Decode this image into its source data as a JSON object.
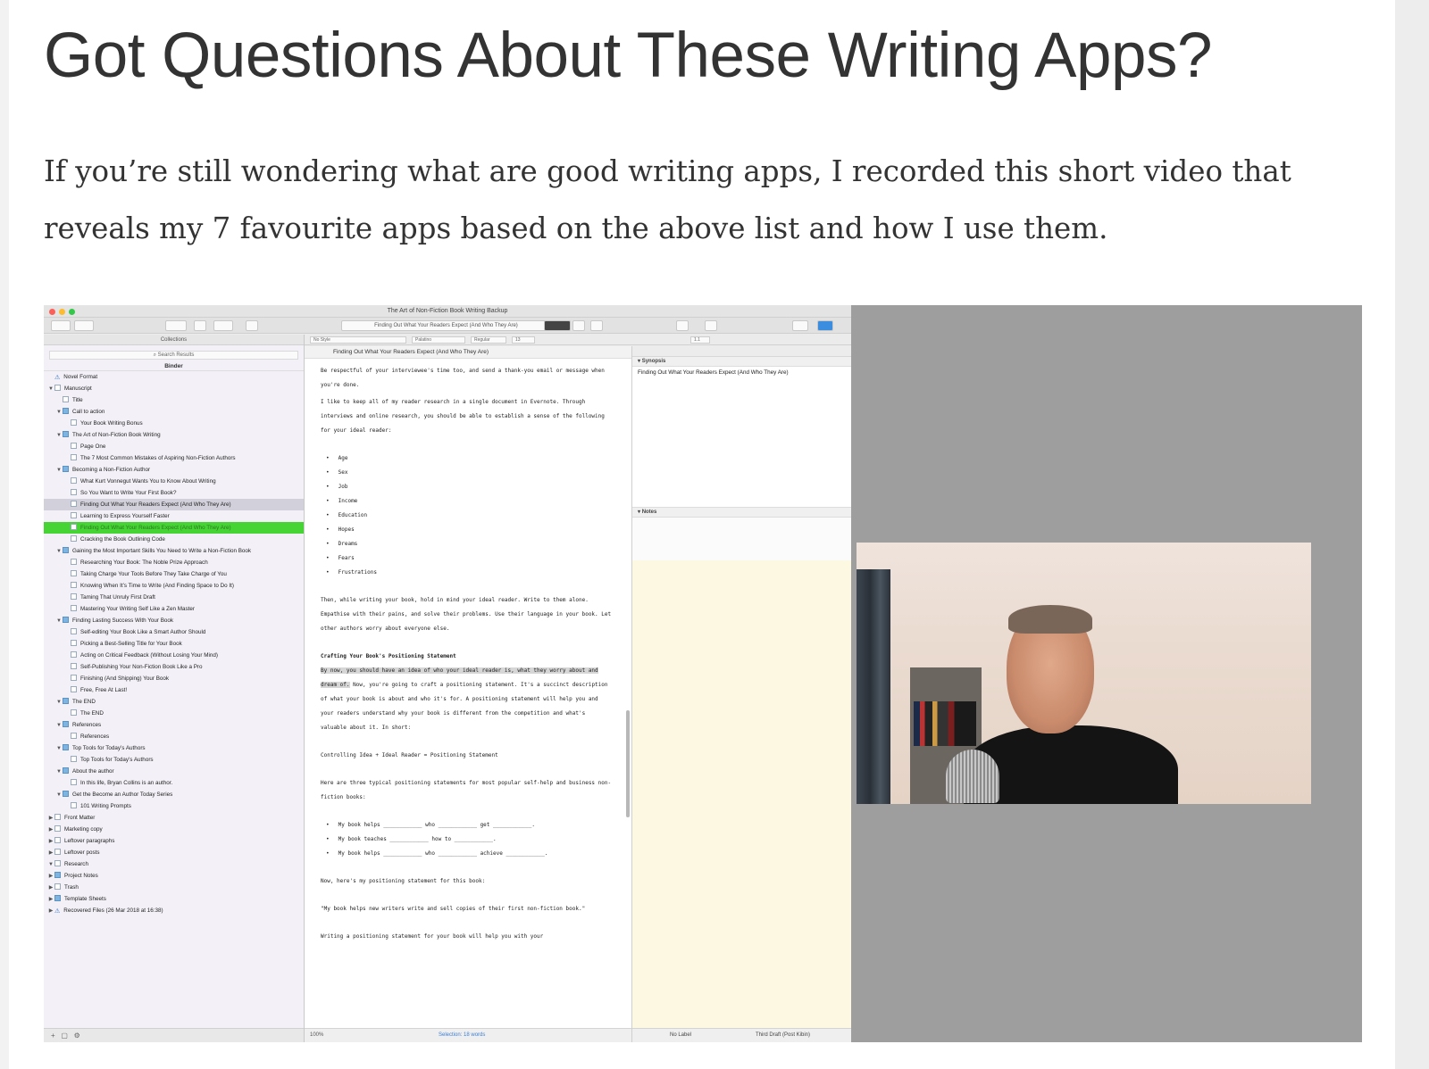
{
  "article": {
    "heading": "Got Questions About These Writing Apps?",
    "intro": "If you’re still wondering what are good writing apps, I recorded this short video that reveals my 7 favourite apps based on the above list and how I use them."
  },
  "app": {
    "window_title": "The Art of Non-Fiction Book Writing Backup",
    "current_document": "Finding Out What Your Readers Expect (And Who They Are)",
    "colors": {
      "drag_highlight": "#46d334",
      "notes_bg": "#fdf8e2",
      "selection": "#d2d0da"
    },
    "format_bar": {
      "style": "No Style",
      "font": "Palatino",
      "weight": "Regular",
      "size": "13",
      "spacing": "1.1"
    },
    "binder": {
      "collections_label": "Collections",
      "search_label": "Search Results",
      "title": "Binder",
      "items": [
        {
          "level": 0,
          "label": "Novel Format",
          "icon": "warning"
        },
        {
          "level": 0,
          "label": "Manuscript",
          "arrow": "▼"
        },
        {
          "level": 1,
          "label": "Title"
        },
        {
          "level": 1,
          "label": "Call to action",
          "arrow": "▼",
          "icon": "folder"
        },
        {
          "level": 2,
          "label": "Your Book Writing Bonus"
        },
        {
          "level": 1,
          "label": "The Art of Non-Fiction Book Writing",
          "arrow": "▼",
          "icon": "folder"
        },
        {
          "level": 2,
          "label": "Page One"
        },
        {
          "level": 2,
          "label": "The 7 Most Common Mistakes of Aspiring Non-Fiction Authors"
        },
        {
          "level": 1,
          "label": "Becoming a Non-Fiction Author",
          "arrow": "▼",
          "icon": "folder"
        },
        {
          "level": 2,
          "label": "What Kurt Vonnegut Wants You to Know About Writing"
        },
        {
          "level": 2,
          "label": "So You Want to Write Your First Book?"
        },
        {
          "level": 2,
          "label": "Finding Out What Your Readers Expect (And Who They Are)",
          "state": "selected"
        },
        {
          "level": 2,
          "label": "Learning to Express Yourself Faster"
        },
        {
          "level": 2,
          "label": "Finding Out What Your Readers Expect (And Who They Are)",
          "state": "drag"
        },
        {
          "level": 2,
          "label": "Cracking the Book Outlining Code"
        },
        {
          "level": 1,
          "label": "Gaining the Most Important Skills You Need to Write a Non-Fiction Book",
          "arrow": "▼",
          "icon": "folder"
        },
        {
          "level": 2,
          "label": "Researching Your Book: The Noble Prize Approach"
        },
        {
          "level": 2,
          "label": "Taking Charge Your Tools Before They Take Charge of You"
        },
        {
          "level": 2,
          "label": "Knowing When It’s Time to Write (And Finding Space to Do It)"
        },
        {
          "level": 2,
          "label": "Taming That Unruly First Draft"
        },
        {
          "level": 2,
          "label": "Mastering Your Writing Self Like a Zen Master"
        },
        {
          "level": 1,
          "label": "Finding Lasting Success With Your Book",
          "arrow": "▼",
          "icon": "folder"
        },
        {
          "level": 2,
          "label": "Self-editing Your Book Like a Smart Author Should"
        },
        {
          "level": 2,
          "label": "Picking a Best-Selling Title for Your Book"
        },
        {
          "level": 2,
          "label": "Acting on Critical Feedback (Without Losing Your Mind)"
        },
        {
          "level": 2,
          "label": "Self-Publishing Your Non-Fiction Book Like a Pro"
        },
        {
          "level": 2,
          "label": "Finishing (And Shipping) Your Book"
        },
        {
          "level": 2,
          "label": "Free, Free At Last!"
        },
        {
          "level": 1,
          "label": "The END",
          "arrow": "▼",
          "icon": "folder"
        },
        {
          "level": 2,
          "label": "The END"
        },
        {
          "level": 1,
          "label": "References",
          "arrow": "▼",
          "icon": "folder"
        },
        {
          "level": 2,
          "label": "References"
        },
        {
          "level": 1,
          "label": "Top Tools for Today’s Authors",
          "arrow": "▼",
          "icon": "folder"
        },
        {
          "level": 2,
          "label": "Top Tools for Today’s Authors"
        },
        {
          "level": 1,
          "label": "About the author",
          "arrow": "▼",
          "icon": "folder"
        },
        {
          "level": 2,
          "label": "In this life, Bryan Collins is an author."
        },
        {
          "level": 1,
          "label": "Get the Become an Author Today Series",
          "arrow": "▼",
          "icon": "folder"
        },
        {
          "level": 2,
          "label": "101 Writing Prompts"
        },
        {
          "level": 0,
          "label": "Front Matter",
          "arrow": "▶"
        },
        {
          "level": 0,
          "label": "Marketing copy",
          "arrow": "▶"
        },
        {
          "level": 0,
          "label": "Leftover paragraphs",
          "arrow": "▶"
        },
        {
          "level": 0,
          "label": "Leftover posts",
          "arrow": "▶"
        },
        {
          "level": 0,
          "label": "Research",
          "arrow": "▼"
        },
        {
          "level": 0,
          "label": "Project Notes",
          "arrow": "▶",
          "icon": "folder"
        },
        {
          "level": 0,
          "label": "Trash",
          "arrow": "▶"
        },
        {
          "level": 0,
          "label": "Template Sheets",
          "arrow": "▶",
          "icon": "folder"
        },
        {
          "level": 0,
          "label": "Recovered Files (26 Mar 2018 at 16:38)",
          "arrow": "▶",
          "icon": "warning"
        }
      ]
    },
    "editor": {
      "p1": "Be respectful of your interviewee's time too, and send a thank-you email or message when you're done.",
      "p2": "I like to keep all of my reader research in a single document in Evernote. Through interviews and online research, you should be able to establish a sense of the following for your ideal reader:",
      "bullets": [
        "Age",
        "Sex",
        "Job",
        "Income",
        "Education",
        "Hopes",
        "Dreams",
        "Fears",
        "Frustrations"
      ],
      "p3": "Then, while writing your book, hold in mind your ideal reader. Write to them alone. Empathise with their pains, and solve their problems. Use their language in your book. Let other authors worry about everyone else.",
      "subhead": "Crafting Your Book's Positioning Statement",
      "p4_hl": "By now, you should have an idea of who your ideal reader is, what they worry about and dream of.",
      "p4_rest": " Now, you're going to craft a positioning statement. It's a succinct description of what your book is about and who it's for. A positioning statement will help you and your readers understand why your book is different from the competition and what's valuable about it. In short:",
      "formula": "Controlling Idea + Ideal Reader = Positioning Statement",
      "p5": "Here are three typical positioning statements for most popular self-help and business non-fiction books:",
      "statements": [
        "My book helps ____________ who ____________ get ____________.",
        "My book teaches ____________ how to ____________.",
        "My book helps ____________ who ____________ achieve ____________."
      ],
      "p6": "Now, here's my positioning statement for this book:",
      "p7": "\"My book helps new writers write and sell copies of their first non-fiction book.\"",
      "p8": "Writing a positioning statement for your book will help you with your"
    },
    "editor_footer": {
      "zoom": "100%",
      "selection": "Selection: 18 words"
    },
    "inspector": {
      "synopsis_label": "Synopsis",
      "synopsis_text": "Finding Out What Your Readers Expect (And Who They Are)",
      "notes_label": "Notes",
      "label_value": "No Label",
      "status_value": "Third Draft (Post Kibin)"
    }
  }
}
